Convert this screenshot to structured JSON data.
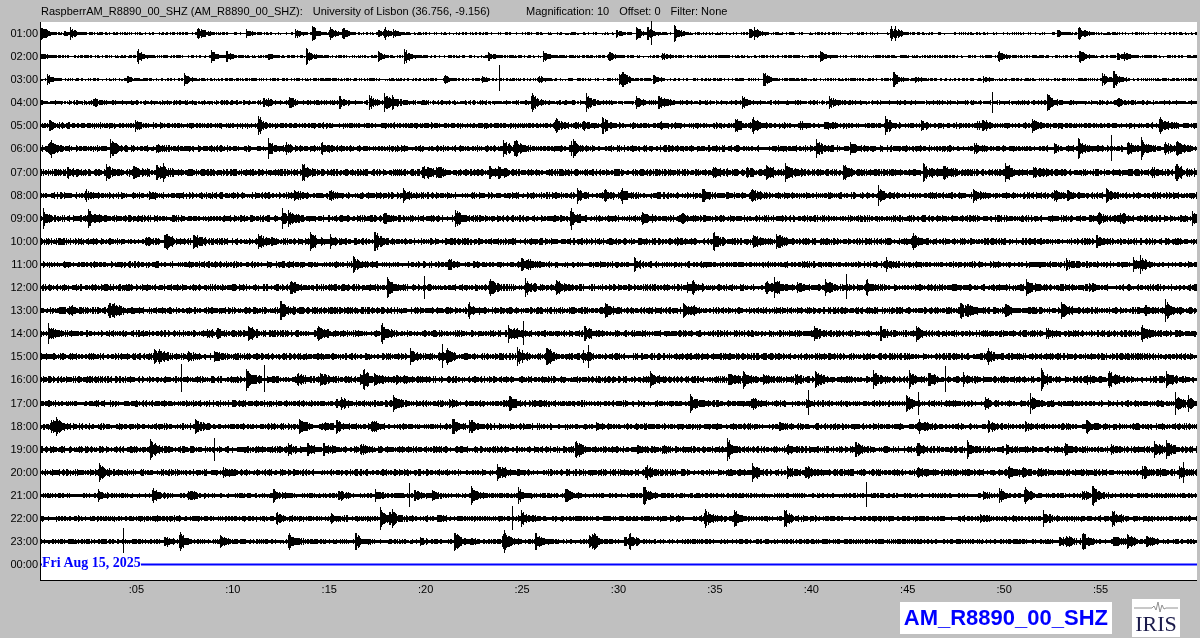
{
  "header": {
    "station": "RaspberrAM_R8890_00_SHZ (AM_R8890_00_SHZ):",
    "location": "University of Lisbon (36.756, -9.156)",
    "magnification": "Magnification: 10",
    "offset": "Offset: 0",
    "filter": "Filter: None"
  },
  "helicorder": {
    "rows": [
      {
        "label": "01:00",
        "current": false
      },
      {
        "label": "02:00",
        "current": false
      },
      {
        "label": "03:00",
        "current": false
      },
      {
        "label": "04:00",
        "current": false
      },
      {
        "label": "05:00",
        "current": false
      },
      {
        "label": "06:00",
        "current": false
      },
      {
        "label": "07:00",
        "current": false
      },
      {
        "label": "08:00",
        "current": false
      },
      {
        "label": "09:00",
        "current": false
      },
      {
        "label": "10:00",
        "current": false
      },
      {
        "label": "11:00",
        "current": false
      },
      {
        "label": "12:00",
        "current": false
      },
      {
        "label": "13:00",
        "current": false
      },
      {
        "label": "14:00",
        "current": false
      },
      {
        "label": "15:00",
        "current": false
      },
      {
        "label": "16:00",
        "current": false
      },
      {
        "label": "17:00",
        "current": false
      },
      {
        "label": "18:00",
        "current": false
      },
      {
        "label": "19:00",
        "current": false
      },
      {
        "label": "20:00",
        "current": false
      },
      {
        "label": "21:00",
        "current": false
      },
      {
        "label": "22:00",
        "current": false
      },
      {
        "label": "23:00",
        "current": false
      },
      {
        "label": "00:00",
        "current": true
      }
    ],
    "date_label": "Fri Aug 15, 2025",
    "x_ticks": [
      ":05",
      ":10",
      ":15",
      ":20",
      ":25",
      ":30",
      ":35",
      ":40",
      ":45",
      ":50",
      ":55"
    ]
  },
  "station_badge": "AM_R8890_00_SHZ",
  "logo": {
    "text": "IRIS"
  }
}
